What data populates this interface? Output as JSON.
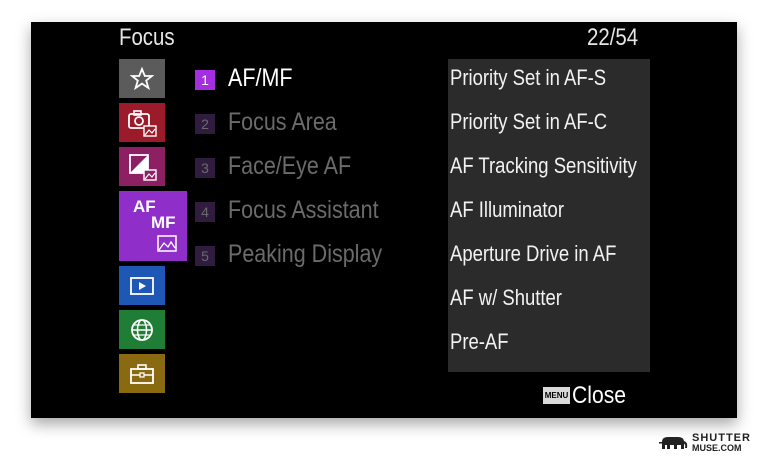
{
  "header": {
    "title": "Focus",
    "page_indicator": "22/54"
  },
  "tabs": {
    "afmf": {
      "line1": "AF",
      "line2": "MF"
    },
    "colors": {
      "star": "#5b5b5b",
      "camera": "#9b1b2a",
      "exposure": "#8d1f63",
      "afmf": "#8f2ec9",
      "playback": "#1e57b5",
      "network": "#1f7d35",
      "setup": "#8a6a10"
    }
  },
  "menu": {
    "items": [
      {
        "number": "1",
        "label": "AF/MF",
        "active": true
      },
      {
        "number": "2",
        "label": "Focus Area",
        "active": false
      },
      {
        "number": "3",
        "label": "Face/Eye AF",
        "active": false
      },
      {
        "number": "4",
        "label": "Focus Assistant",
        "active": false
      },
      {
        "number": "5",
        "label": "Peaking Display",
        "active": false
      }
    ]
  },
  "submenu": {
    "items": [
      "Priority Set in AF-S",
      "Priority Set in AF-C",
      "AF Tracking Sensitivity",
      "AF Illuminator",
      "Aperture Drive in AF",
      "AF w/ Shutter",
      "Pre-AF"
    ]
  },
  "footer": {
    "menu_badge": "MENU",
    "close_label": "Close"
  },
  "watermark": {
    "line1": "SHUTTER",
    "line2": "MUSE.COM"
  }
}
